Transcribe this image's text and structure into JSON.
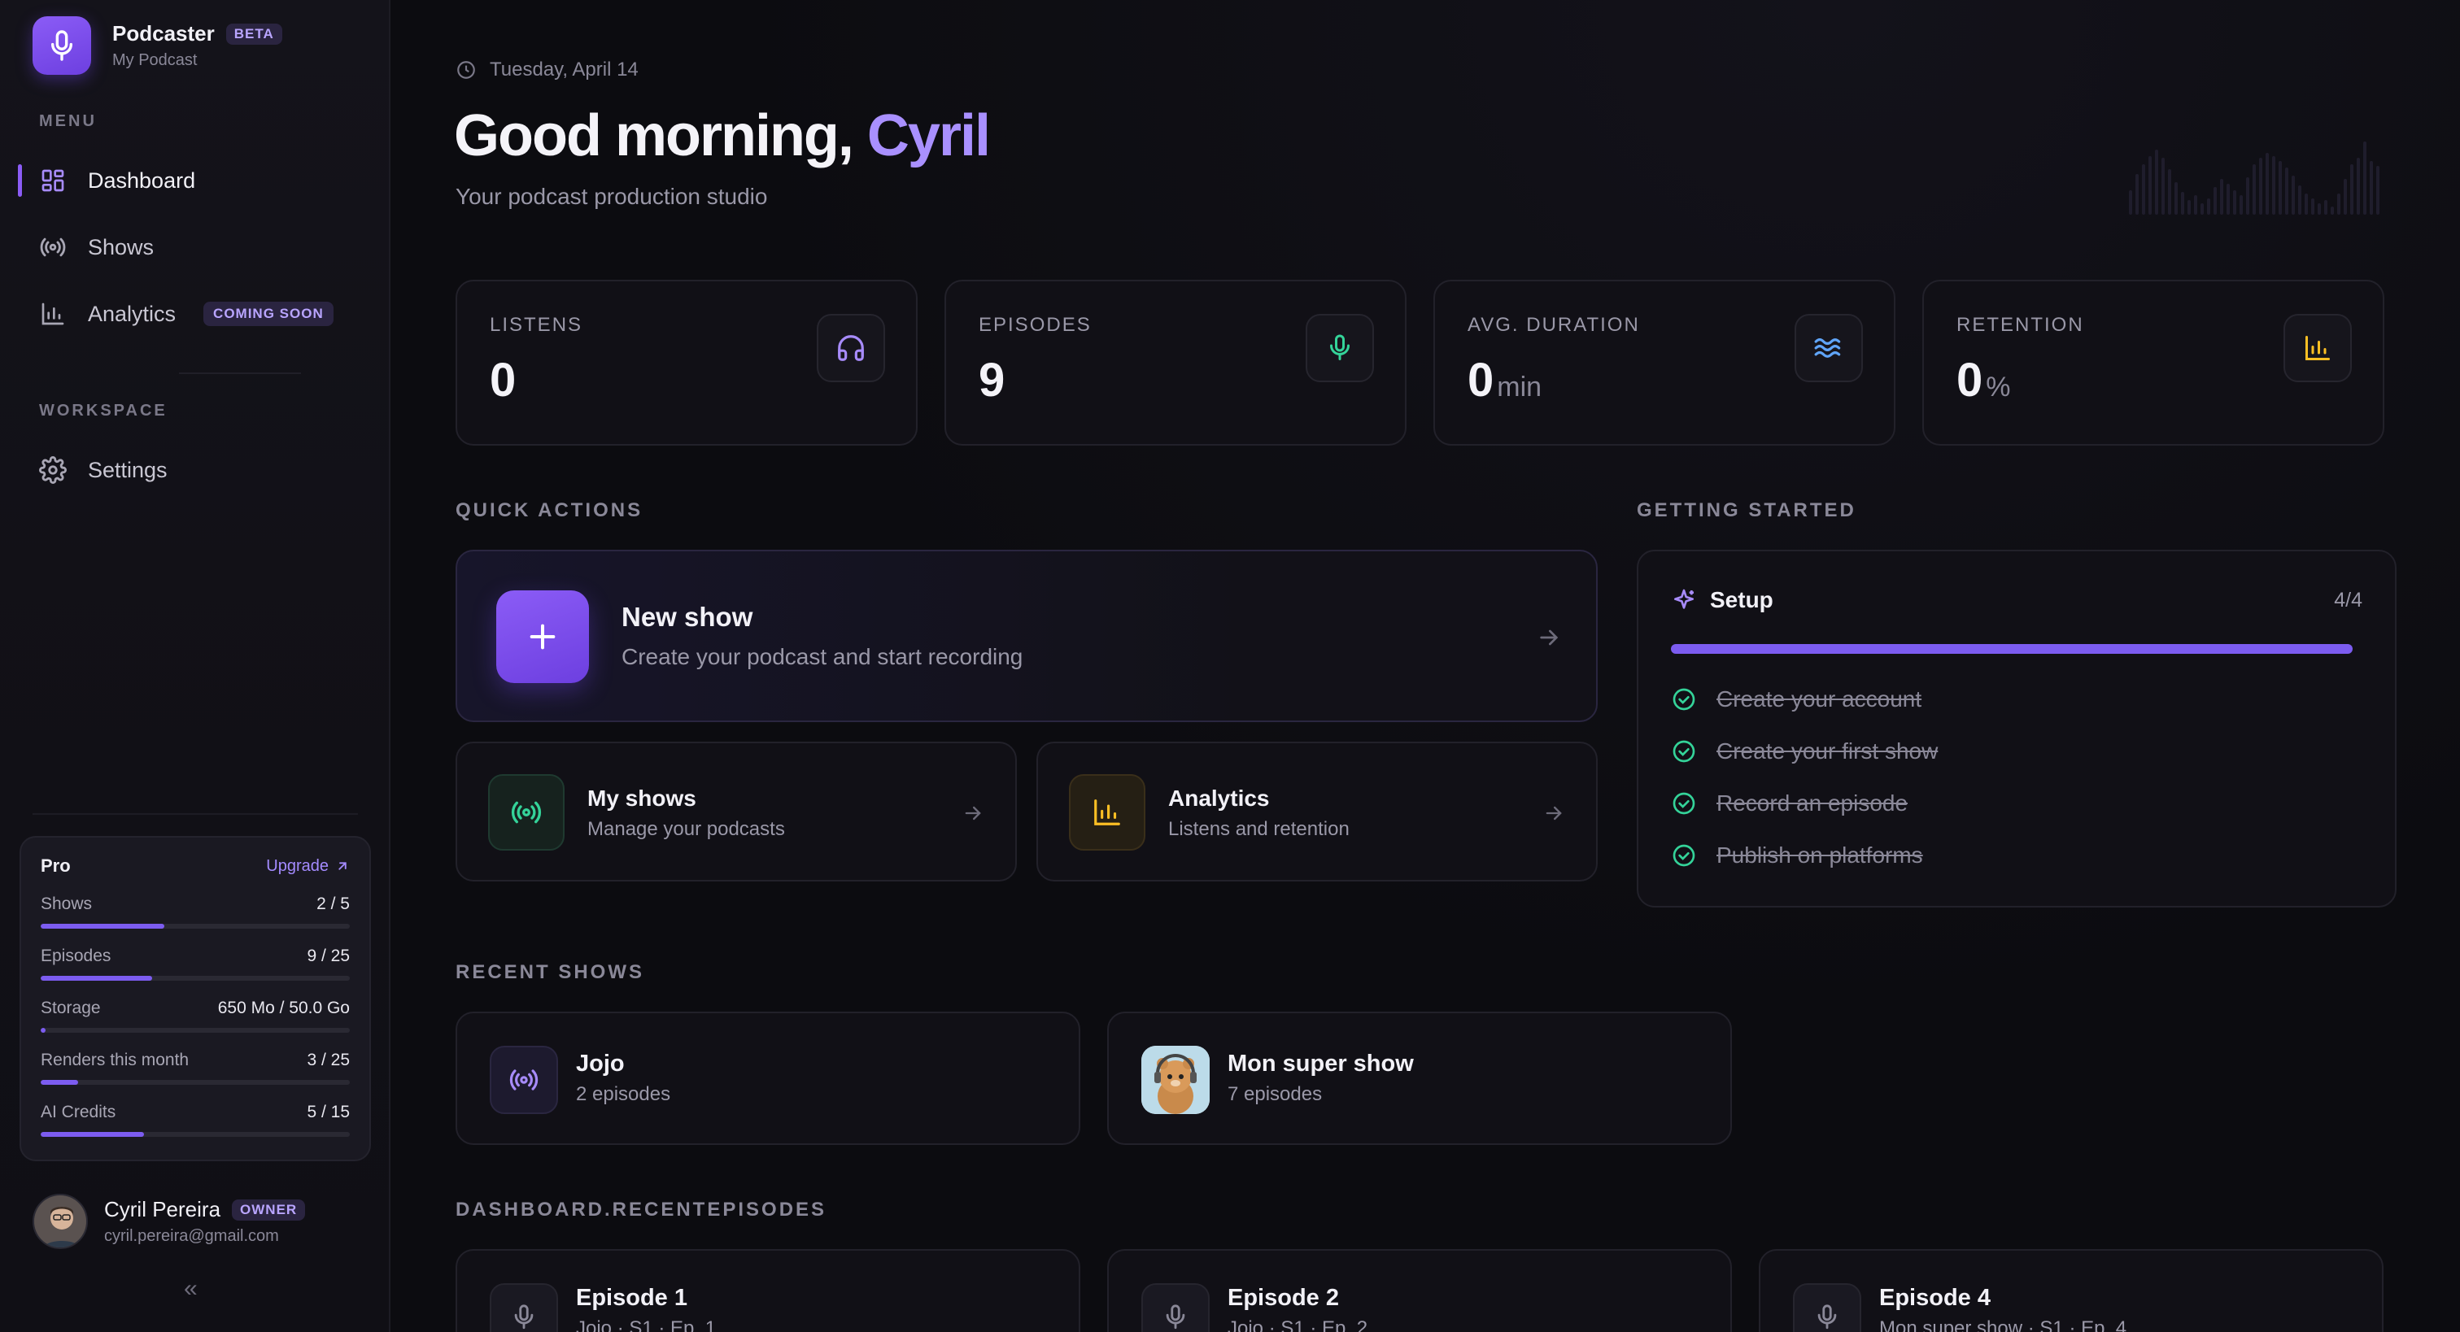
{
  "brand": {
    "name": "Podcaster",
    "badge": "BETA",
    "workspace": "My Podcast"
  },
  "sidebar": {
    "menu_label": "MENU",
    "items": [
      {
        "label": "Dashboard",
        "icon": "grid-icon",
        "active": true
      },
      {
        "label": "Shows",
        "icon": "broadcast-icon"
      },
      {
        "label": "Analytics",
        "icon": "bar-chart-icon",
        "badge": "COMING SOON"
      }
    ],
    "workspace_label": "WORKSPACE",
    "settings_label": "Settings"
  },
  "plan": {
    "name": "Pro",
    "upgrade_label": "Upgrade",
    "quotas": [
      {
        "name": "Shows",
        "value": "2 / 5",
        "fraction": 0.4
      },
      {
        "name": "Episodes",
        "value": "9 / 25",
        "fraction": 0.36
      },
      {
        "name": "Storage",
        "value": "650 Mo / 50.0 Go",
        "fraction": 0.013
      },
      {
        "name": "Renders this month",
        "value": "3 / 25",
        "fraction": 0.12
      },
      {
        "name": "AI Credits",
        "value": "5 / 15",
        "fraction": 0.333
      }
    ]
  },
  "user": {
    "name": "Cyril Pereira",
    "role": "OWNER",
    "email": "cyril.pereira@gmail.com"
  },
  "collapse_label": "«",
  "header": {
    "date": "Tuesday, April 14",
    "greeting": "Good morning, ",
    "name": "Cyril",
    "subtitle": "Your podcast production studio"
  },
  "stats": [
    {
      "label": "LISTENS",
      "value": "0",
      "unit": "",
      "icon": "headphones-icon",
      "color": "#a78bfa"
    },
    {
      "label": "EPISODES",
      "value": "9",
      "unit": "",
      "icon": "microphone-icon",
      "color": "#34d399"
    },
    {
      "label": "AVG. DURATION",
      "value": "0",
      "unit": "min",
      "icon": "waves-icon",
      "color": "#60a5fa"
    },
    {
      "label": "RETENTION",
      "value": "0",
      "unit": "%",
      "icon": "bar-chart-icon",
      "color": "#fbbf24"
    }
  ],
  "quick_actions": {
    "label": "QUICK ACTIONS",
    "new_show": {
      "title": "New show",
      "subtitle": "Create your podcast and start recording"
    },
    "my_shows": {
      "title": "My shows",
      "subtitle": "Manage your podcasts"
    },
    "analytics": {
      "title": "Analytics",
      "subtitle": "Listens and retention"
    }
  },
  "getting_started": {
    "label": "GETTING STARTED",
    "title": "Setup",
    "count": "4/4",
    "progress": 1.0,
    "tasks": [
      "Create your account",
      "Create your first show",
      "Record an episode",
      "Publish on platforms"
    ]
  },
  "recent_shows": {
    "label": "RECENT SHOWS",
    "items": [
      {
        "title": "Jojo",
        "subtitle": "2 episodes"
      },
      {
        "title": "Mon super show",
        "subtitle": "7 episodes"
      }
    ]
  },
  "recent_episodes": {
    "label": "DASHBOARD.RECENTEPISODES",
    "items": [
      {
        "title": "Episode 1",
        "subtitle": "Jojo · S1 · Ep. 1"
      },
      {
        "title": "Episode 2",
        "subtitle": "Jojo · S1 · Ep. 2"
      },
      {
        "title": "Episode 4",
        "subtitle": "Mon super show · S1 · Ep. 4"
      }
    ]
  }
}
